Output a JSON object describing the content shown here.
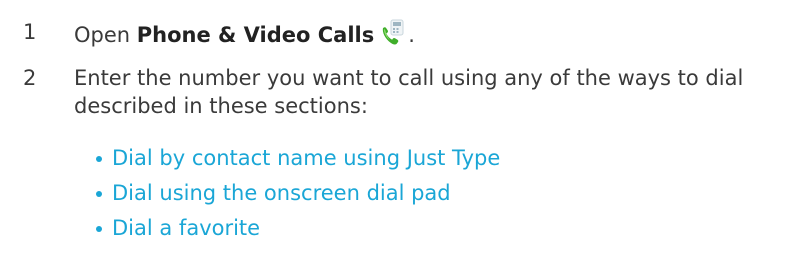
{
  "steps": [
    {
      "number": "1",
      "prefix": "Open ",
      "app_name": "Phone & Video Calls",
      "suffix": ".",
      "icon": "phone-video-calls-icon"
    },
    {
      "number": "2",
      "text": "Enter the number you want to call using any of the ways to dial described in these sections:"
    }
  ],
  "links": [
    "Dial by contact name using Just Type",
    "Dial using the onscreen dial pad",
    "Dial a favorite"
  ],
  "colors": {
    "link": "#1aa6d6",
    "text": "#3a3a3a"
  }
}
